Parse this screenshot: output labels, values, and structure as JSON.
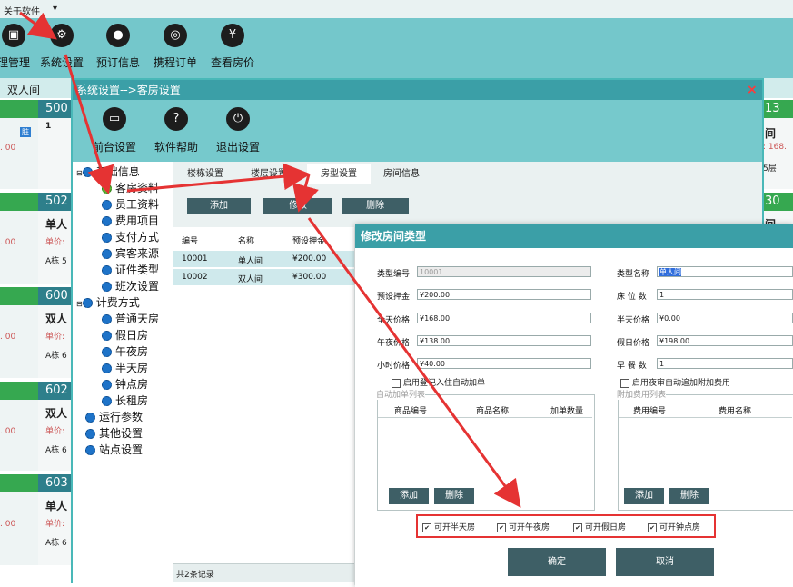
{
  "menubar": {
    "items": [
      "关于软件",
      "▾"
    ]
  },
  "toolbar": {
    "buttons": [
      {
        "label": "理管理",
        "icon": "lock-icon"
      },
      {
        "label": "系统设置",
        "icon": "gear-icon"
      },
      {
        "label": "预订信息",
        "icon": "booking-icon"
      },
      {
        "label": "携程订单",
        "icon": "ctrip-icon"
      },
      {
        "label": "查看房价",
        "icon": "price-search-icon"
      }
    ]
  },
  "subbar": {
    "label": "双人间"
  },
  "background": {
    "rooms": [
      {
        "num": "500",
        "lines": [
          "1",
          "",
          ""
        ]
      },
      {
        "num": "502",
        "lines": [
          "单人",
          "单价:",
          "A栋 5"
        ]
      },
      {
        "num": "600",
        "lines": [
          "双人",
          "单价:",
          "A栋 6"
        ]
      },
      {
        "num": "602",
        "lines": [
          "双人",
          "单价:",
          "A栋 6"
        ]
      },
      {
        "num": "603",
        "lines": [
          "单人",
          "单价:",
          "A栋 6"
        ]
      }
    ],
    "left_prices": [
      ". 00",
      ". 00",
      ". 00",
      ". 00",
      ". 00"
    ],
    "dirty_badge": "脏",
    "right_rooms": [
      {
        "num": "13",
        "lines": [
          "间",
          ": 168.",
          "5层"
        ]
      },
      {
        "num": "30",
        "lines": [
          "间",
          "",
          ""
        ]
      }
    ]
  },
  "window": {
    "title": "系统设置-->客房设置",
    "close": "×",
    "toolbar": [
      {
        "label": "前台设置",
        "icon": "monitor-icon"
      },
      {
        "label": "软件帮助",
        "icon": "help-icon"
      },
      {
        "label": "退出设置",
        "icon": "power-icon"
      }
    ],
    "tree": {
      "groups": [
        {
          "label": "基础信息",
          "children": [
            "客房资料",
            "员工资料",
            "费用项目",
            "支付方式",
            "宾客来源",
            "证件类型",
            "班次设置"
          ]
        },
        {
          "label": "计费方式",
          "children": [
            "普通天房",
            "假日房",
            "午夜房",
            "半天房",
            "钟点房",
            "长租房"
          ]
        }
      ],
      "others": [
        "运行参数",
        "其他设置",
        "站点设置"
      ]
    },
    "tabs": [
      "楼栋设置",
      "楼层设置",
      "房型设置",
      "房间信息"
    ],
    "actions": {
      "add": "添加",
      "edit": "修改",
      "delete": "删除"
    },
    "grid": {
      "headers": [
        "编号",
        "名称",
        "预设押金"
      ],
      "rows": [
        [
          "10001",
          "单人间",
          "¥200.00"
        ],
        [
          "10002",
          "双人间",
          "¥300.00"
        ]
      ],
      "footer": "共2条记录"
    }
  },
  "dialog": {
    "title": "修改房间类型",
    "fields_left": [
      {
        "label": "类型编号",
        "value": "10001"
      },
      {
        "label": "预设押金",
        "value": "¥200.00"
      },
      {
        "label": "全天价格",
        "value": "¥168.00"
      },
      {
        "label": "午夜价格",
        "value": "¥138.00"
      },
      {
        "label": "小时价格",
        "value": "¥40.00"
      }
    ],
    "fields_right": [
      {
        "label": "类型名称",
        "value": "单人间"
      },
      {
        "label": "床 位 数",
        "value": "1"
      },
      {
        "label": "半天价格",
        "value": "¥0.00"
      },
      {
        "label": "假日价格",
        "value": "¥198.00"
      },
      {
        "label": "早 餐 数",
        "value": "1"
      }
    ],
    "checkbox_left": "启用登记入住自动加单",
    "checkbox_right": "启用夜审自动追加附加费用",
    "list_left": {
      "title": "自动加单列表",
      "headers": [
        "商品编号",
        "商品名称",
        "加单数量"
      ],
      "add": "添加",
      "delete": "删除"
    },
    "list_right": {
      "title": "附加费用列表",
      "headers": [
        "费用编号",
        "费用名称"
      ],
      "add": "添加",
      "delete": "删除"
    },
    "options": [
      "可开半天房",
      "可开午夜房",
      "可开假日房",
      "可开钟点房"
    ],
    "check_mark": "✔",
    "ok": "确定",
    "cancel": "取消"
  },
  "colors": {
    "teal": "#3b9fa7",
    "toolbar": "#76c9cc",
    "button_dark": "#3e5f66",
    "annotation_red": "#e53333"
  }
}
